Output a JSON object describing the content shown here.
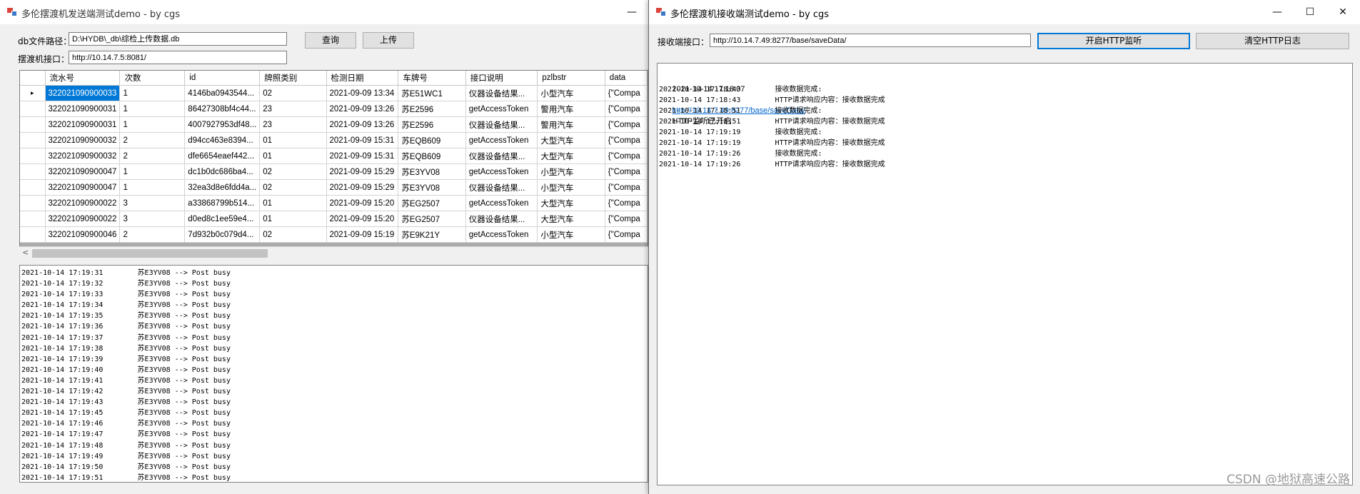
{
  "sender": {
    "title": "多伦摆渡机发送端测试demo - by cgs",
    "minimize": "—",
    "db_label": "db文件路径：",
    "db_value": "D:\\HYDB\\_db\\综检上传数据.db",
    "port_label": "摆渡机接口：",
    "port_value": "http://10.14.7.5:8081/",
    "query_button": "查询",
    "upload_button": "上传",
    "grid": {
      "row_marker": "▸",
      "columns": [
        "流水号",
        "次数",
        "id",
        "牌照类别",
        "检测日期",
        "车牌号",
        "接口说明",
        "pzlbstr",
        "data"
      ],
      "rows": [
        [
          "322021090900033",
          "1",
          "4146ba0943544...",
          "02",
          "2021-09-09 13:34",
          "苏E51WC1",
          "仪器设备结果...",
          "小型汽车",
          "{\"Compa"
        ],
        [
          "322021090900031",
          "1",
          "86427308bf4c44...",
          "23",
          "2021-09-09 13:26",
          "苏E2596",
          "getAccessToken",
          "警用汽车",
          "{\"Compa"
        ],
        [
          "322021090900031",
          "1",
          "4007927953df48...",
          "23",
          "2021-09-09 13:26",
          "苏E2596",
          "仪器设备结果...",
          "警用汽车",
          "{\"Compa"
        ],
        [
          "322021090900032",
          "2",
          "d94cc463e8394...",
          "01",
          "2021-09-09 15:31",
          "苏EQB609",
          "getAccessToken",
          "大型汽车",
          "{\"Compa"
        ],
        [
          "322021090900032",
          "2",
          "dfe6654eaef442...",
          "01",
          "2021-09-09 15:31",
          "苏EQB609",
          "仪器设备结果...",
          "大型汽车",
          "{\"Compa"
        ],
        [
          "322021090900047",
          "1",
          "dc1b0dc686ba4...",
          "02",
          "2021-09-09 15:29",
          "苏E3YV08",
          "getAccessToken",
          "小型汽车",
          "{\"Compa"
        ],
        [
          "322021090900047",
          "1",
          "32ea3d8e6fdd4a...",
          "02",
          "2021-09-09 15:29",
          "苏E3YV08",
          "仪器设备结果...",
          "小型汽车",
          "{\"Compa"
        ],
        [
          "322021090900022",
          "3",
          "a33868799b514...",
          "01",
          "2021-09-09 15:20",
          "苏EG2507",
          "getAccessToken",
          "大型汽车",
          "{\"Compa"
        ],
        [
          "322021090900022",
          "3",
          "d0ed8c1ee59e4...",
          "01",
          "2021-09-09 15:20",
          "苏EG2507",
          "仪器设备结果...",
          "大型汽车",
          "{\"Compa"
        ],
        [
          "322021090900046",
          "2",
          "7d932b0c079d4...",
          "02",
          "2021-09-09 15:19",
          "苏E9K21Y",
          "getAccessToken",
          "小型汽车",
          "{\"Compa"
        ]
      ]
    },
    "scroll_left": "<",
    "log": [
      "2021-10-14 17:19:31        苏E3YV08 --> Post busy",
      "2021-10-14 17:19:32        苏E3YV08 --> Post busy",
      "2021-10-14 17:19:33        苏E3YV08 --> Post busy",
      "2021-10-14 17:19:34        苏E3YV08 --> Post busy",
      "2021-10-14 17:19:35        苏E3YV08 --> Post busy",
      "2021-10-14 17:19:36        苏E3YV08 --> Post busy",
      "2021-10-14 17:19:37        苏E3YV08 --> Post busy",
      "2021-10-14 17:19:38        苏E3YV08 --> Post busy",
      "2021-10-14 17:19:39        苏E3YV08 --> Post busy",
      "2021-10-14 17:19:40        苏E3YV08 --> Post busy",
      "2021-10-14 17:19:41        苏E3YV08 --> Post busy",
      "2021-10-14 17:19:42        苏E3YV08 --> Post busy",
      "2021-10-14 17:19:43        苏E3YV08 --> Post busy",
      "2021-10-14 17:19:45        苏E3YV08 --> Post busy",
      "2021-10-14 17:19:46        苏E3YV08 --> Post busy",
      "2021-10-14 17:19:47        苏E3YV08 --> Post busy",
      "2021-10-14 17:19:48        苏E3YV08 --> Post busy",
      "2021-10-14 17:19:49        苏E3YV08 --> Post busy",
      "2021-10-14 17:19:50        苏E3YV08 --> Post busy",
      "2021-10-14 17:19:51        苏E3YV08 --> Post busy"
    ]
  },
  "receiver": {
    "title": "多伦摆渡机接收端测试demo - by cgs",
    "minimize": "—",
    "maximize": "☐",
    "close": "✕",
    "port_label": "接收端接口：",
    "port_value": "http://10.14.7.49:8277/base/saveData/",
    "start_button": "开启HTTP监听",
    "clear_button": "清空HTTP日志",
    "log_first": {
      "time": "2021-10-14 17:18:07",
      "url": "http://10.14.7.49:8277/base/saveData/",
      "text": "HTTP监听已开启"
    },
    "log": [
      "2021-10-14 17:18:43        接收数据完成:",
      "2021-10-14 17:18:43        HTTP请求响应内容：接收数据完成",
      "2021-10-14 17:18:51        接收数据完成:",
      "2021-10-14 17:18:51        HTTP请求响应内容：接收数据完成",
      "2021-10-14 17:19:19        接收数据完成:",
      "2021-10-14 17:19:19        HTTP请求响应内容：接收数据完成",
      "2021-10-14 17:19:26        接收数据完成:",
      "2021-10-14 17:19:26        HTTP请求响应内容：接收数据完成"
    ]
  },
  "watermark": "CSDN @地狱高速公路"
}
